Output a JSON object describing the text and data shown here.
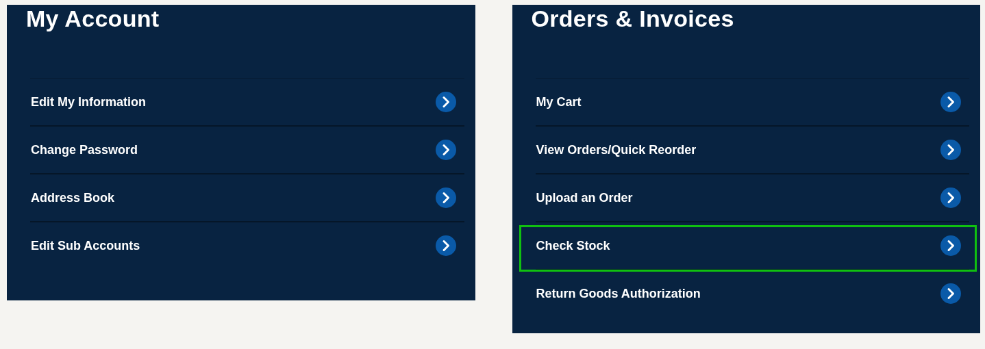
{
  "panels": [
    {
      "title": "My Account",
      "items": [
        {
          "label": "Edit My Information",
          "highlighted": false
        },
        {
          "label": "Change Password",
          "highlighted": false
        },
        {
          "label": "Address Book",
          "highlighted": false
        },
        {
          "label": "Edit Sub Accounts",
          "highlighted": false
        }
      ]
    },
    {
      "title": "Orders & Invoices",
      "items": [
        {
          "label": "My Cart",
          "highlighted": false
        },
        {
          "label": "View Orders/Quick Reorder",
          "highlighted": false
        },
        {
          "label": "Upload an Order",
          "highlighted": false
        },
        {
          "label": "Check Stock",
          "highlighted": true
        },
        {
          "label": "Return Goods Authorization",
          "highlighted": false
        }
      ]
    }
  ]
}
